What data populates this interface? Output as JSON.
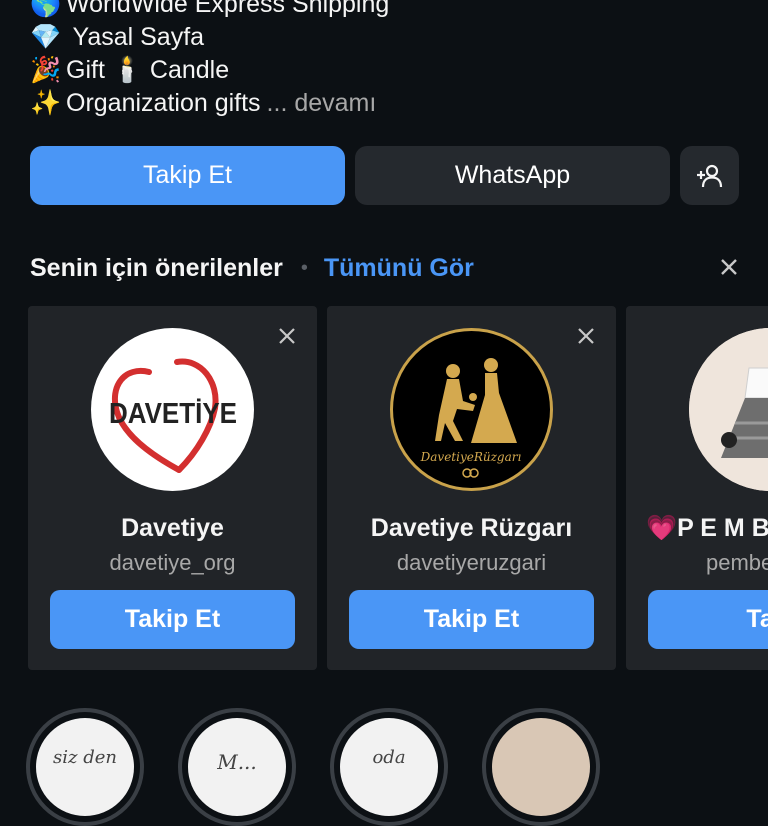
{
  "bio": {
    "lines": [
      {
        "icon": "🌎",
        "text": "WorldWide Express Shipping"
      },
      {
        "icon": "💎",
        "text": " Yasal Sayfa"
      },
      {
        "icon": "🎉",
        "text": "Gift 🕯️ Candle"
      },
      {
        "icon": "✨",
        "text": "Organization gifts"
      }
    ],
    "more": "... devamı"
  },
  "actions": {
    "follow_label": "Takip Et",
    "whatsapp_label": "WhatsApp",
    "add_person_icon": "add-person-icon"
  },
  "suggestions": {
    "title": "Senin için önerilenler",
    "see_all": "Tümünü Gör",
    "cards": [
      {
        "name": "Davetiye",
        "handle": "davetiye_org",
        "follow": "Takip Et",
        "logo_text": "DAVETİYE"
      },
      {
        "name": "Davetiye Rüzgarı",
        "handle": "davetiyeruzgari",
        "follow": "Takip Et",
        "logo_text": "DavetiyeRüzgarı"
      },
      {
        "name": "💗P E M B",
        "handle": "pembe",
        "follow": "Taki"
      }
    ]
  },
  "highlights": [
    {
      "text": "siz den"
    },
    {
      "text": "M..."
    },
    {
      "text": "oda"
    },
    {
      "text": ""
    }
  ],
  "colors": {
    "background": "#0c1014",
    "accent": "#4a96f6",
    "card": "#212428",
    "button_dark": "#25292e",
    "muted_text": "#a8a8a8"
  }
}
